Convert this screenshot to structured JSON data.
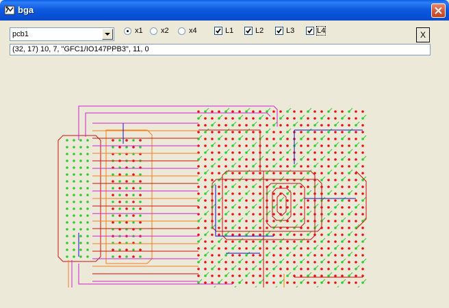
{
  "window": {
    "title": "bga",
    "icon": "bga-app-icon",
    "close_icon": "close-icon"
  },
  "toolbar": {
    "combo": {
      "value": "pcb1"
    },
    "zoom": [
      {
        "label": "x1",
        "checked": true
      },
      {
        "label": "x2",
        "checked": false
      },
      {
        "label": "x4",
        "checked": false
      }
    ],
    "layers": [
      {
        "label": "L1",
        "checked": true
      },
      {
        "label": "L2",
        "checked": true
      },
      {
        "label": "L3",
        "checked": true
      },
      {
        "label": "L4",
        "checked": true
      }
    ],
    "clear_button": "X"
  },
  "status": {
    "text": "(32, 17) 10, 7, \"GFC1/IO147PPB3\", 11, 0"
  },
  "board": {
    "colors": {
      "pad": "#E81010",
      "via": "#2ECC2E",
      "layer_red": "#D01010",
      "layer_orange": "#F08020",
      "layer_magenta": "#D020D0",
      "layer_blue": "#1010C8"
    }
  }
}
